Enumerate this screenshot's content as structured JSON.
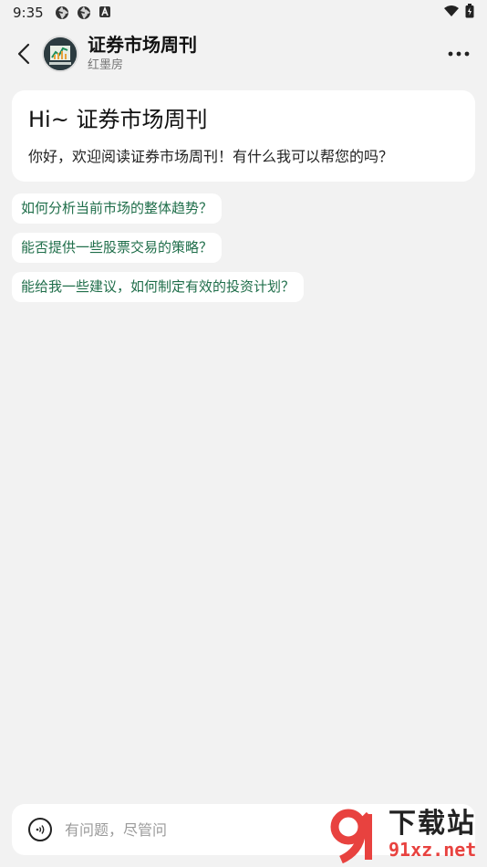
{
  "status_bar": {
    "time": "9:35",
    "icons": [
      "aperture-icon",
      "aperture-icon",
      "a-badge-icon"
    ],
    "right_icons": [
      "wifi-icon",
      "battery-icon"
    ]
  },
  "header": {
    "title": "证券市场周刊",
    "subtitle": "红墨房",
    "back_icon": "chevron-left-icon",
    "more_icon": "more-horizontal-icon"
  },
  "welcome": {
    "title": "Hi~ 证券市场周刊",
    "text": "你好，欢迎阅读证券市场周刊！有什么我可以帮您的吗？"
  },
  "suggestions": [
    "如何分析当前市场的整体趋势？",
    "能否提供一些股票交易的策略？",
    "能给我一些建议，如何制定有效的投资计划？"
  ],
  "input": {
    "placeholder": "有问题，尽管问",
    "voice_icon": "voice-icon"
  },
  "watermark": {
    "top": "下载站",
    "bottom": "91xz.net"
  },
  "colors": {
    "background": "#f2f2f2",
    "chip_text": "#1f6e4a",
    "watermark_red": "#e8423f"
  }
}
